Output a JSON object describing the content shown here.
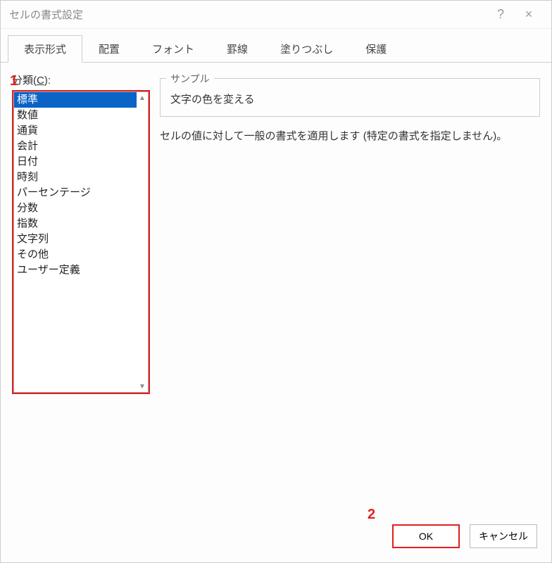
{
  "titlebar": {
    "title": "セルの書式設定",
    "help": "?",
    "close": "×"
  },
  "tabs": [
    "表示形式",
    "配置",
    "フォント",
    "罫線",
    "塗りつぶし",
    "保護"
  ],
  "activeTab": 0,
  "category": {
    "label_prefix": "分類(",
    "label_u": "C",
    "label_suffix": "):"
  },
  "categories": [
    "標準",
    "数値",
    "通貨",
    "会計",
    "日付",
    "時刻",
    "パーセンテージ",
    "分数",
    "指数",
    "文字列",
    "その他",
    "ユーザー定義"
  ],
  "selectedCategory": 0,
  "sample": {
    "legend": "サンプル",
    "value": "文字の色を変える"
  },
  "description": "セルの値に対して一般の書式を適用します (特定の書式を指定しません)。",
  "buttons": {
    "ok": "OK",
    "cancel": "キャンセル"
  },
  "callouts": {
    "c1": "1",
    "c2": "2"
  }
}
